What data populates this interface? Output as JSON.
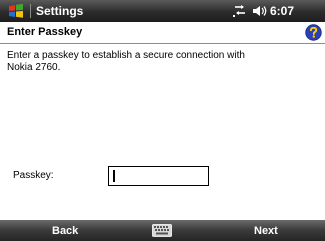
{
  "titlebar": {
    "title": "Settings",
    "time": "6:07",
    "icons": [
      "windows-start-icon",
      "connectivity-icon",
      "volume-icon"
    ]
  },
  "header": {
    "title": "Enter Passkey",
    "help_icon": "help-icon"
  },
  "content": {
    "instruction": "Enter a passkey to establish a secure connection with Nokia 2760.",
    "passkey_label": "Passkey:",
    "passkey_value": ""
  },
  "menubar": {
    "left_label": "Back",
    "right_label": "Next",
    "center_icon": "keyboard-icon"
  },
  "colors": {
    "titlebar_top": "#5a5a5a",
    "titlebar_bottom": "#1e1e1e",
    "help_icon_blue": "#2a3fb8",
    "help_icon_yellow": "#ffd000"
  }
}
